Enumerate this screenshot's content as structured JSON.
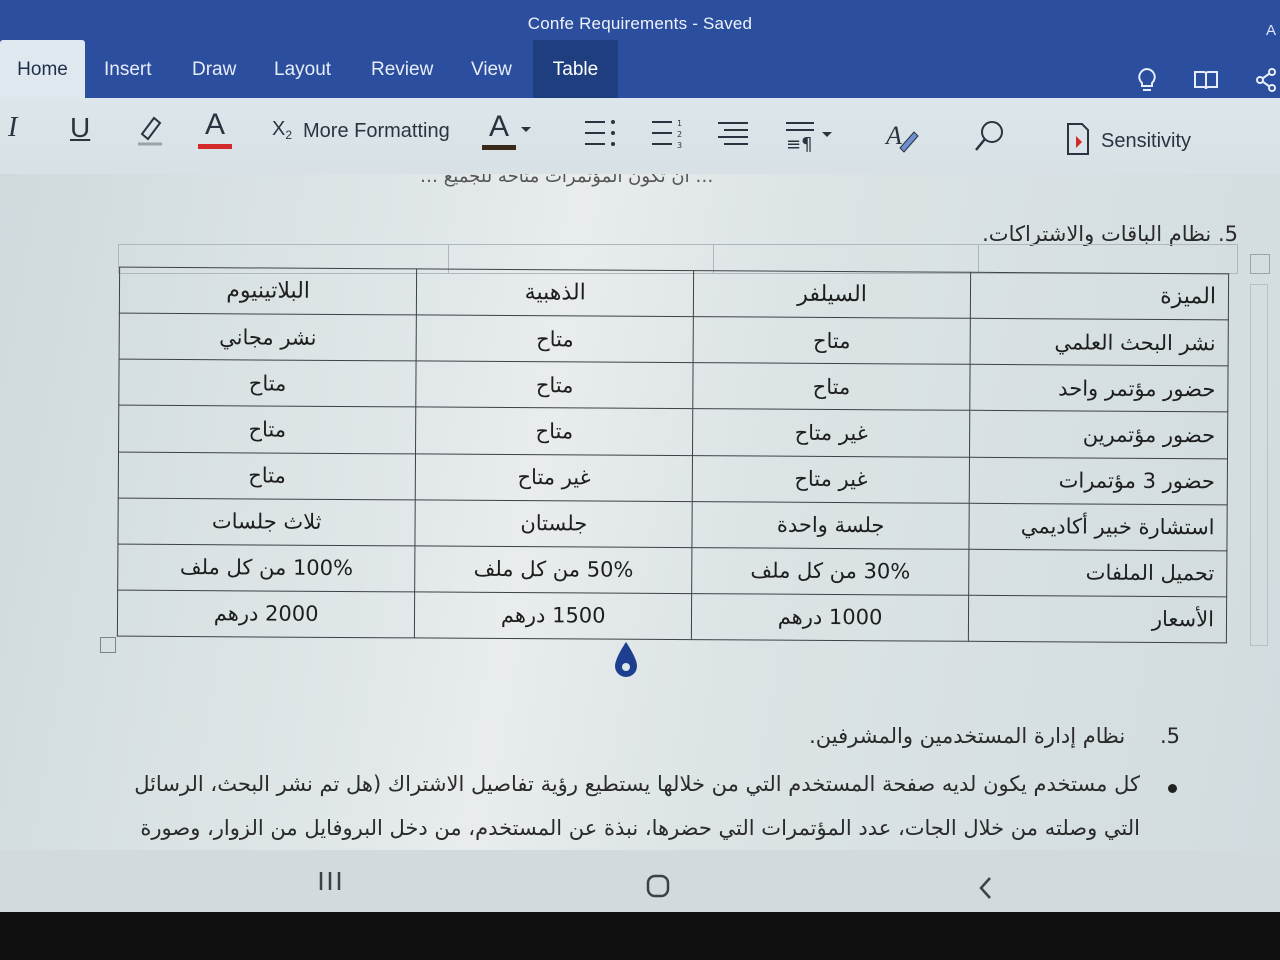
{
  "window": {
    "title": "Confe Requirements  - Saved",
    "corner_char": "A"
  },
  "tabs": [
    {
      "label": "Home"
    },
    {
      "label": "Insert"
    },
    {
      "label": "Draw"
    },
    {
      "label": "Layout"
    },
    {
      "label": "Review"
    },
    {
      "label": "View"
    },
    {
      "label": "Table"
    }
  ],
  "tab_icons": [
    "lightbulb-icon",
    "book-icon",
    "share-icon"
  ],
  "toolbar": {
    "italic": "I",
    "underline": "U",
    "font_color": "A",
    "subscript_x": "X",
    "subscript_2": "2",
    "more_formatting": "More Formatting",
    "styles_a": "A",
    "sensitivity": "Sensitivity"
  },
  "colors": {
    "ribbon_blue": "#2b4f9e",
    "font_color_red": "#d22a2a",
    "styles_underline": "#3a2a1a",
    "cursor_blue": "#1e3f8f"
  },
  "document": {
    "cut_line": "… أن تكون المؤتمرات متاحة للجميع …",
    "section_heading": "5. نظام الباقات والاشتراكات.",
    "table": {
      "header": [
        "الميزة",
        "السيلفر",
        "الذهبية",
        "البلاتينيوم"
      ],
      "rows": [
        [
          "نشر البحث العلمي",
          "متاح",
          "متاح",
          "نشر مجاني"
        ],
        [
          "حضور مؤتمر واحد",
          "متاح",
          "متاح",
          "متاح"
        ],
        [
          "حضور مؤتمرين",
          "غير متاح",
          "متاح",
          "متاح"
        ],
        [
          "حضور 3 مؤتمرات",
          "غير متاح",
          "غير متاح",
          "متاح"
        ],
        [
          "استشارة خبير أكاديمي",
          "جلسة واحدة",
          "جلستان",
          "ثلاث جلسات"
        ],
        [
          "تحميل الملفات",
          "30% من كل ملف",
          "50% من كل ملف",
          "100% من كل ملف"
        ],
        [
          "الأسعار",
          "1000 درهم",
          "1500 درهم",
          "2000 درهم"
        ]
      ]
    },
    "numbered_item": {
      "number": "5.",
      "text": "نظام إدارة المستخدمين والمشرفين."
    },
    "bullet_lines": [
      "كل مستخدم يكون لديه صفحة المستخدم التي من خلالها يستطيع رؤية تفاصيل الاشتراك (هل تم نشر البحث، الرسائل",
      "التي وصلته من خلال الجات، عدد المؤتمرات التي حضرها، نبذة عن المستخدم، من دخل البروفايل من الزوار، وصورة"
    ]
  },
  "navbar": {
    "icons": [
      "recent-apps-icon",
      "home-icon",
      "back-icon"
    ]
  }
}
